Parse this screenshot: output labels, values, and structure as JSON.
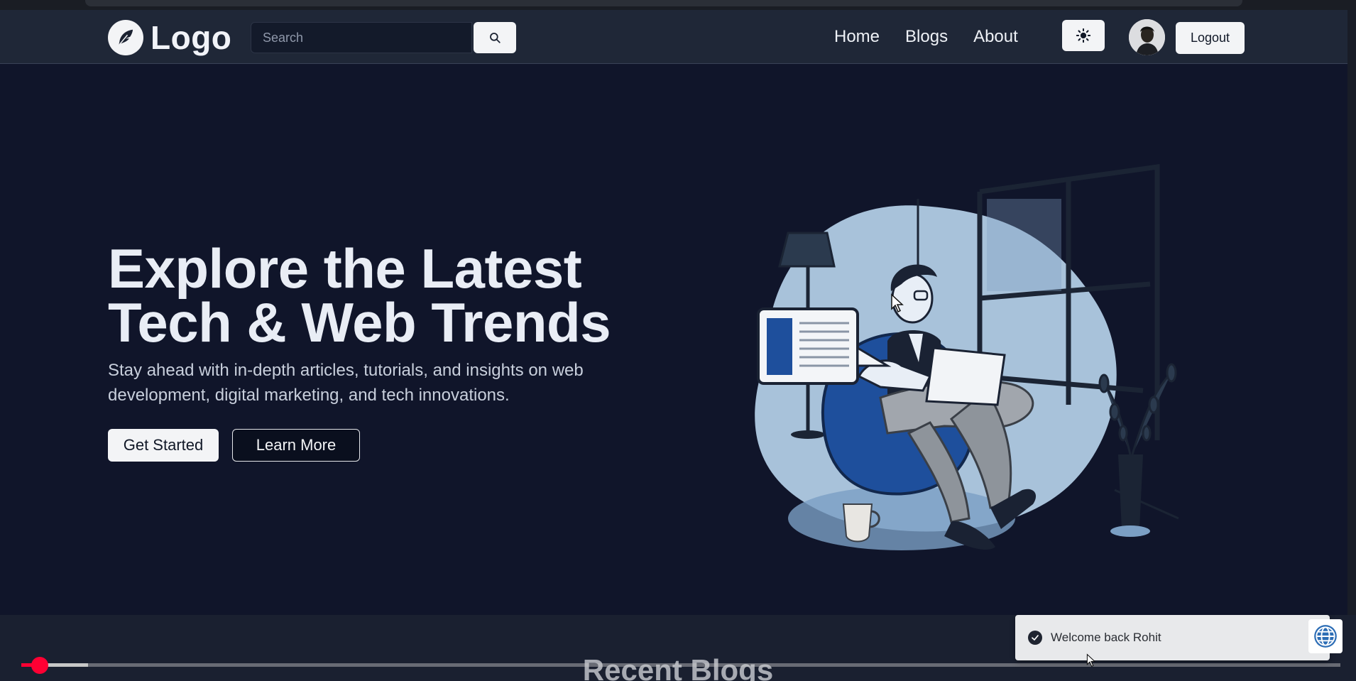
{
  "navbar": {
    "logo_text": "Logo",
    "search_placeholder": "Search",
    "links": [
      "Home",
      "Blogs",
      "About"
    ],
    "logout_label": "Logout"
  },
  "hero": {
    "title": "Explore the Latest Tech & Web Trends",
    "subtitle": "Stay ahead with in-depth articles, tutorials, and insights on web development, digital marketing, and tech innovations.",
    "primary_button": "Get Started",
    "secondary_button": "Learn More"
  },
  "recent": {
    "title": "Recent Blogs"
  },
  "toast": {
    "message": "Welcome back Rohit"
  },
  "icons": {
    "logo": "feather-icon",
    "search": "search-icon",
    "theme": "sun-icon",
    "toast": "check-circle-icon",
    "badge": "globe-icon"
  },
  "colors": {
    "background": "#10152a",
    "navbar": "#1f2737",
    "accent_light": "#f3f4f6",
    "progress": "#ff0033"
  }
}
